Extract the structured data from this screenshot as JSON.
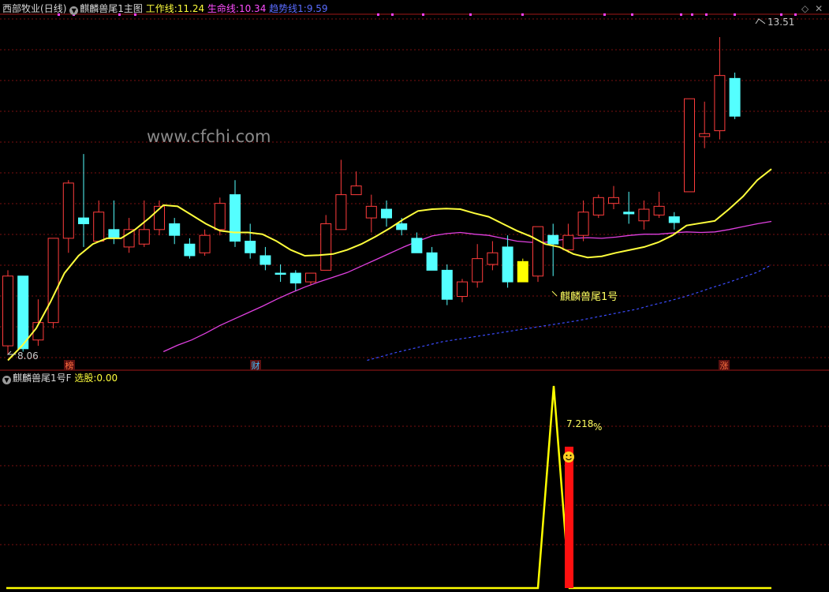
{
  "header": {
    "stock": "西部牧业",
    "period": "(日线)",
    "indicator": "麒麟兽尾1主图",
    "work_label": "工作线:",
    "work_value": "11.24",
    "life_label": "生命线:",
    "life_value": "10.34",
    "trend_label": "趋势线1:",
    "trend_value": "9.59"
  },
  "sub_header": {
    "indicator": "麒麟兽尾1号F",
    "select_label": "选股:",
    "select_value": "0.00"
  },
  "watermark": "www.cfchi.com",
  "colors": {
    "up": "#ff3c3c",
    "down": "#54ffff",
    "signal": "#ffff00",
    "work": "#ffff3c",
    "life": "#e040e0",
    "trend": "#3c4cff",
    "grid": "#7a1010"
  },
  "chart_data": [
    {
      "type": "candlestick",
      "title": "麒麟兽尾1主图",
      "ylim": [
        7.93,
        13.85
      ],
      "annotations": {
        "max_label": "13.51",
        "min_label": "8.06",
        "signal_label": "麒麟兽尾1号"
      },
      "event_markers": [
        "榜",
        "财",
        "涨"
      ],
      "candles": [
        {
          "o": 8.2,
          "c": 9.4,
          "h": 9.5,
          "l": 8.06
        },
        {
          "o": 9.4,
          "c": 8.15,
          "h": 9.4,
          "l": 8.1
        },
        {
          "o": 8.3,
          "c": 8.6,
          "h": 9.0,
          "l": 8.2
        },
        {
          "o": 8.6,
          "c": 10.05,
          "h": 10.05,
          "l": 8.5
        },
        {
          "o": 10.05,
          "c": 11.0,
          "h": 11.05,
          "l": 9.8
        },
        {
          "o": 10.4,
          "c": 10.3,
          "h": 11.5,
          "l": 9.9
        },
        {
          "o": 10.0,
          "c": 10.5,
          "h": 10.7,
          "l": 10.0
        },
        {
          "o": 10.2,
          "c": 10.05,
          "h": 10.7,
          "l": 9.95
        },
        {
          "o": 9.9,
          "c": 10.2,
          "h": 10.4,
          "l": 9.8
        },
        {
          "o": 9.95,
          "c": 10.2,
          "h": 10.7,
          "l": 9.9
        },
        {
          "o": 10.2,
          "c": 10.6,
          "h": 10.7,
          "l": 10.1
        },
        {
          "o": 10.3,
          "c": 10.1,
          "h": 10.4,
          "l": 9.95
        },
        {
          "o": 9.95,
          "c": 9.75,
          "h": 10.05,
          "l": 9.7
        },
        {
          "o": 9.8,
          "c": 10.1,
          "h": 10.2,
          "l": 9.75
        },
        {
          "o": 10.2,
          "c": 10.65,
          "h": 10.75,
          "l": 10.1
        },
        {
          "o": 10.8,
          "c": 10.0,
          "h": 11.05,
          "l": 9.9
        },
        {
          "o": 10.0,
          "c": 9.8,
          "h": 10.3,
          "l": 9.7
        },
        {
          "o": 9.75,
          "c": 9.6,
          "h": 9.9,
          "l": 9.5
        },
        {
          "o": 9.45,
          "c": 9.43,
          "h": 9.6,
          "l": 9.3
        },
        {
          "o": 9.45,
          "c": 9.28,
          "h": 9.5,
          "l": 9.15
        },
        {
          "o": 9.3,
          "c": 9.45,
          "h": 9.45,
          "l": 9.25
        },
        {
          "o": 9.5,
          "c": 10.3,
          "h": 10.45,
          "l": 9.5
        },
        {
          "o": 10.2,
          "c": 10.8,
          "h": 11.4,
          "l": 10.2
        },
        {
          "o": 10.8,
          "c": 10.95,
          "h": 11.2,
          "l": 10.8
        },
        {
          "o": 10.4,
          "c": 10.6,
          "h": 10.8,
          "l": 10.15
        },
        {
          "o": 10.55,
          "c": 10.4,
          "h": 10.7,
          "l": 10.25
        },
        {
          "o": 10.3,
          "c": 10.2,
          "h": 10.4,
          "l": 10.1
        },
        {
          "o": 10.05,
          "c": 9.8,
          "h": 10.15,
          "l": 9.8
        },
        {
          "o": 9.8,
          "c": 9.5,
          "h": 9.9,
          "l": 9.5
        },
        {
          "o": 9.5,
          "c": 9.0,
          "h": 9.6,
          "l": 8.9
        },
        {
          "o": 9.05,
          "c": 9.3,
          "h": 9.35,
          "l": 8.95
        },
        {
          "o": 9.3,
          "c": 9.7,
          "h": 9.95,
          "l": 9.2
        },
        {
          "o": 9.6,
          "c": 9.8,
          "h": 10.0,
          "l": 9.5
        },
        {
          "o": 9.9,
          "c": 9.3,
          "h": 10.1,
          "l": 9.2
        },
        {
          "o": 9.3,
          "c": 9.65,
          "h": 9.7,
          "l": 9.3,
          "signal": true
        },
        {
          "o": 9.4,
          "c": 10.25,
          "h": 10.25,
          "l": 9.3
        },
        {
          "o": 10.1,
          "c": 9.95,
          "h": 10.3,
          "l": 9.4
        },
        {
          "o": 9.85,
          "c": 10.1,
          "h": 10.3,
          "l": 9.8
        },
        {
          "o": 10.1,
          "c": 10.5,
          "h": 10.7,
          "l": 10.0
        },
        {
          "o": 10.45,
          "c": 10.75,
          "h": 10.8,
          "l": 10.4
        },
        {
          "o": 10.65,
          "c": 10.75,
          "h": 10.95,
          "l": 10.55
        },
        {
          "o": 10.5,
          "c": 10.47,
          "h": 10.85,
          "l": 10.3
        },
        {
          "o": 10.35,
          "c": 10.55,
          "h": 10.7,
          "l": 10.2
        },
        {
          "o": 10.45,
          "c": 10.6,
          "h": 10.85,
          "l": 10.4
        },
        {
          "o": 10.42,
          "c": 10.32,
          "h": 10.5,
          "l": 10.2
        },
        {
          "o": 10.85,
          "c": 12.45,
          "h": 12.45,
          "l": 10.85
        },
        {
          "o": 11.8,
          "c": 11.85,
          "h": 12.4,
          "l": 11.6
        },
        {
          "o": 11.9,
          "c": 12.85,
          "h": 13.51,
          "l": 11.75
        },
        {
          "o": 12.8,
          "c": 12.15,
          "h": 12.9,
          "l": 12.1
        }
      ],
      "series": [
        {
          "name": "工作线",
          "values": [
            7.95,
            8.2,
            8.5,
            8.95,
            9.45,
            9.75,
            9.95,
            10.05,
            10.05,
            10.2,
            10.4,
            10.62,
            10.6,
            10.45,
            10.3,
            10.18,
            10.15,
            10.15,
            10.12,
            10.0,
            9.85,
            9.75,
            9.76,
            9.78,
            9.85,
            9.95,
            10.08,
            10.22,
            10.38,
            10.52,
            10.55,
            10.56,
            10.55,
            10.48,
            10.42,
            10.3,
            10.18,
            10.08,
            9.95,
            9.9,
            9.78,
            9.72,
            9.74,
            9.8,
            9.85,
            9.9,
            9.98,
            10.1,
            10.27,
            10.31,
            10.35,
            10.55,
            10.77,
            11.05,
            11.24
          ]
        },
        {
          "name": "生命线",
          "values": [
            null,
            null,
            null,
            null,
            null,
            null,
            null,
            null,
            null,
            null,
            null,
            8.1,
            8.21,
            8.3,
            8.42,
            8.55,
            8.66,
            8.77,
            8.88,
            9.0,
            9.11,
            9.21,
            9.3,
            9.38,
            9.46,
            9.57,
            9.68,
            9.79,
            9.9,
            10.0,
            10.09,
            10.13,
            10.15,
            10.12,
            10.1,
            10.05,
            10.0,
            9.98,
            9.98,
            10.02,
            10.05,
            10.06,
            10.05,
            10.07,
            10.1,
            10.12,
            10.12,
            10.14,
            10.16,
            10.15,
            10.16,
            10.2,
            10.25,
            10.3,
            10.34
          ]
        },
        {
          "name": "趋势线1",
          "values": [
            null,
            null,
            null,
            null,
            null,
            null,
            null,
            null,
            null,
            null,
            null,
            null,
            null,
            null,
            null,
            null,
            null,
            null,
            null,
            null,
            null,
            null,
            null,
            null,
            7.95,
            8.02,
            8.09,
            8.15,
            8.21,
            8.27,
            8.31,
            8.35,
            8.39,
            8.43,
            8.47,
            8.51,
            8.55,
            8.59,
            8.63,
            8.68,
            8.73,
            8.78,
            8.83,
            8.9,
            8.96,
            9.03,
            9.11,
            9.2,
            9.28,
            9.37,
            9.46,
            9.59
          ]
        }
      ]
    },
    {
      "type": "bar",
      "title": "麒麟兽尾1号F",
      "annotations": {
        "peak_label": "7.218",
        "peak_unit": "%"
      },
      "pulse": {
        "peak": 7.218,
        "signal_candle": 34
      },
      "bars": [
        {
          "candle": 35,
          "value": 5.05
        }
      ]
    }
  ]
}
